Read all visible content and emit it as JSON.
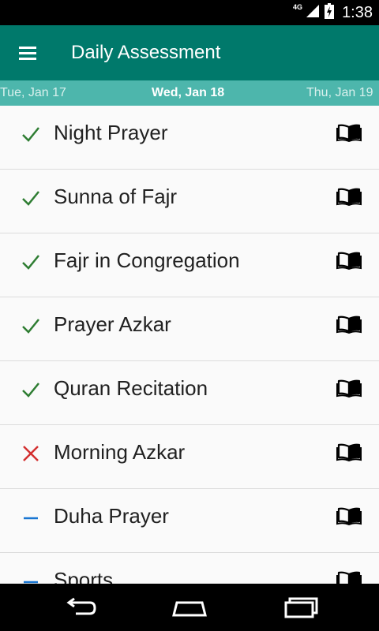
{
  "status_bar": {
    "network_label": "4G",
    "time": "1:38",
    "icons": [
      "signal-icon",
      "battery-charging-icon"
    ]
  },
  "app_bar": {
    "title": "Daily Assessment",
    "menu_icon": "hamburger-menu-icon",
    "background_color": "#00796b"
  },
  "date_nav": {
    "previous": "Tue, Jan 17",
    "current": "Wed, Jan 18",
    "next": "Thu, Jan 19",
    "background_color": "#4db6ac"
  },
  "items": [
    {
      "label": "Night Prayer",
      "status": "done"
    },
    {
      "label": "Sunna of Fajr",
      "status": "done"
    },
    {
      "label": "Fajr in Congregation",
      "status": "done"
    },
    {
      "label": "Prayer Azkar",
      "status": "done"
    },
    {
      "label": "Quran Recitation",
      "status": "done"
    },
    {
      "label": "Morning Azkar",
      "status": "missed"
    },
    {
      "label": "Duha Prayer",
      "status": "pending"
    },
    {
      "label": "Sports",
      "status": "pending"
    }
  ],
  "status_colors": {
    "done": "#2e7d32",
    "missed": "#d32f2f",
    "pending": "#1976d2"
  },
  "item_action_icon": "open-book-icon",
  "nav_bar": {
    "icons": [
      "back-icon",
      "home-icon",
      "recent-apps-icon"
    ]
  }
}
